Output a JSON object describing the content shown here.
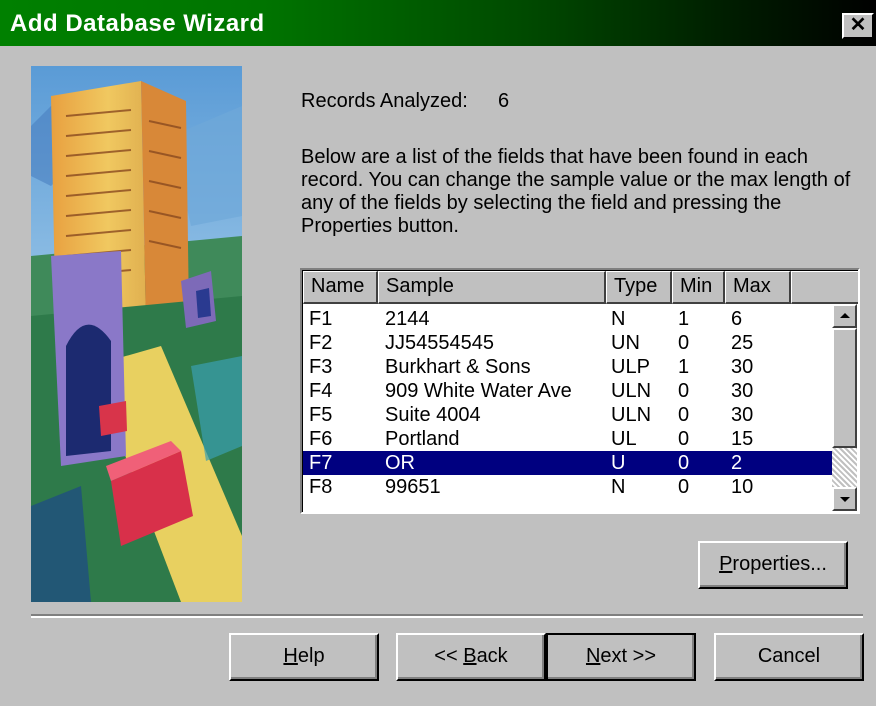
{
  "window": {
    "title": "Add Database Wizard",
    "close_glyph": "✕"
  },
  "records": {
    "label": "Records Analyzed:",
    "value": "6"
  },
  "description": "Below are a list of the fields that have been found in each record.  You can change the sample value or the max length of any of the fields by selecting the field and pressing the Properties button.",
  "fields_table": {
    "columns": [
      "Name",
      "Sample",
      "Type",
      "Min",
      "Max"
    ],
    "rows": [
      [
        "F1",
        "2144",
        "N",
        "1",
        "6"
      ],
      [
        "F2",
        "JJ54554545",
        "UN",
        "0",
        "25"
      ],
      [
        "F3",
        "Burkhart & Sons",
        "ULP",
        "1",
        "30"
      ],
      [
        "F4",
        "909 White Water Ave",
        "ULN",
        "0",
        "30"
      ],
      [
        "F5",
        "Suite 4004",
        "ULN",
        "0",
        "30"
      ],
      [
        "F6",
        "Portland",
        "UL",
        "0",
        "15"
      ],
      [
        "F7",
        "OR",
        "U",
        "0",
        "2"
      ],
      [
        "F8",
        "99651",
        "N",
        "0",
        "10"
      ]
    ],
    "selected_row": "F7"
  },
  "buttons": {
    "properties_accel": "P",
    "properties_rest": "roperties...",
    "help_accel": "H",
    "help_rest": "elp",
    "back_pre": "<< ",
    "back_accel": "B",
    "back_rest": "ack",
    "next_accel": "N",
    "next_rest": "ext >>",
    "cancel": "Cancel"
  },
  "colors": {
    "title_gradient_start": "#008000",
    "title_gradient_end": "#000000",
    "selection": "#000080",
    "face": "#c0c0c0"
  }
}
